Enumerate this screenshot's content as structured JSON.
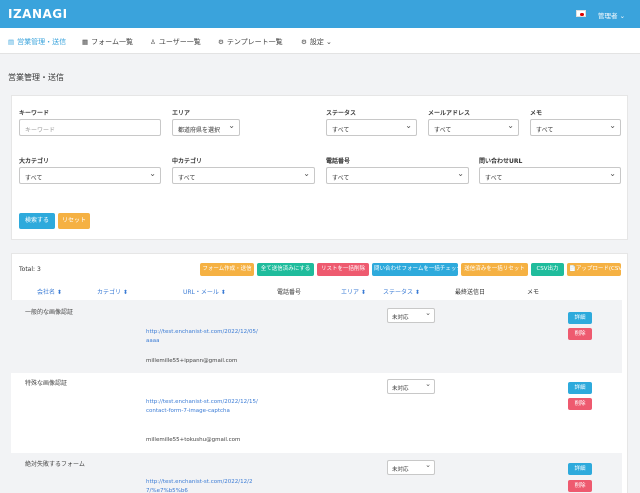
{
  "app": {
    "brand": "IZANAGI",
    "user_label": "管理者 ⌄"
  },
  "nav": [
    {
      "icon": "▤",
      "label": "営業管理・送信"
    },
    {
      "icon": "▦",
      "label": "フォーム一覧"
    },
    {
      "icon": "♙",
      "label": "ユーザー一覧"
    },
    {
      "icon": "⚙",
      "label": "テンプレート一覧"
    },
    {
      "icon": "⚙",
      "label": "設定 ⌄"
    }
  ],
  "page_title": "営業管理・送信",
  "filters": {
    "keyword": {
      "label": "キーワード",
      "placeholder": "キーワード"
    },
    "area": {
      "label": "エリア",
      "value": "都道府県を選択"
    },
    "status": {
      "label": "ステータス",
      "value": "すべて"
    },
    "mail": {
      "label": "メールアドレス",
      "value": "すべて"
    },
    "memo": {
      "label": "メモ",
      "value": "すべて"
    },
    "big_category": {
      "label": "大カテゴリ",
      "value": "すべて"
    },
    "mid_category": {
      "label": "中カテゴリ",
      "value": "すべて"
    },
    "phone": {
      "label": "電話番号",
      "value": "すべて"
    },
    "contact_url": {
      "label": "問い合わせURL",
      "value": "すべて"
    },
    "search_btn": "検索する",
    "reset_btn": "リセット"
  },
  "list": {
    "total": "Total: 3",
    "actions": [
      {
        "label": "フォーム作成・送信",
        "color": "#f5b143"
      },
      {
        "label": "全て送信済みにする",
        "color": "#1fbc9c"
      },
      {
        "label": "リストを一括削除",
        "color": "#ee5a6f"
      },
      {
        "label": "問い合わせフォームを一括チェック",
        "color": "#2eaadc"
      },
      {
        "label": "送信済みを一括リセット",
        "color": "#f5b143"
      },
      {
        "label": "CSV出力",
        "color": "#1fbc9c"
      },
      {
        "label": "📄アップロード(CSV)",
        "color": "#f5b143"
      }
    ],
    "headers": {
      "company": "会社名 ⬍",
      "category": "カテゴリ ⬍",
      "url": "URL・メール ⬍",
      "phone": "電話番号",
      "area": "エリア ⬍",
      "status": "ステータス ⬍",
      "last_sent": "最終送信日",
      "memo": "メモ"
    },
    "rows": [
      {
        "company": "一般的な画像認証",
        "url": "http://test.enchanist-st.com/2022/12/05/aaaa",
        "email": "millemille55+ippann@gmail.com",
        "status": "未対応",
        "detail": "詳細",
        "delete": "削除"
      },
      {
        "company": "特殊な画像認証",
        "url": "http://test.enchanist-st.com/2022/12/15/contact-form-7-image-captcha",
        "email": "millemille55+tokushu@gmail.com",
        "status": "未対応",
        "detail": "詳細",
        "delete": "削除"
      },
      {
        "company": "絶対失敗するフォーム",
        "url": "http://test.enchanist-st.com/2022/12/27/%e7%b5%b6",
        "email": "",
        "status": "未対応",
        "detail": "詳細",
        "delete": "削除"
      }
    ]
  }
}
